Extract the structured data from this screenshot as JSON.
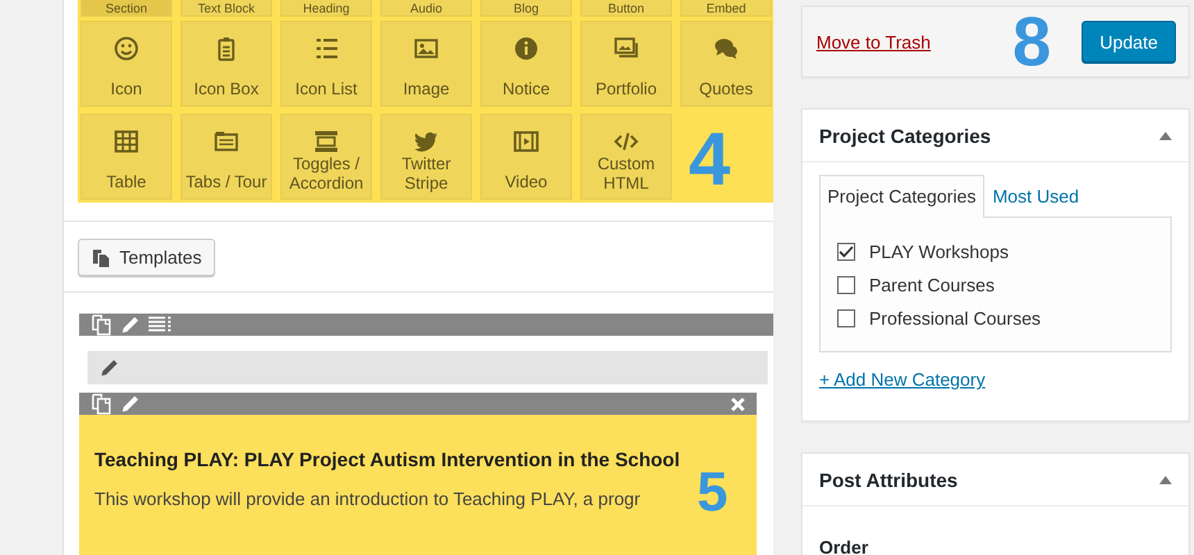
{
  "builder": {
    "cut_row": [
      "Section",
      "Text Block",
      "Heading",
      "Audio",
      "Blog",
      "Button",
      "Embed"
    ],
    "tiles": [
      {
        "label": "Icon",
        "kind": "smiley"
      },
      {
        "label": "Icon Box",
        "kind": "clipboard"
      },
      {
        "label": "Icon List",
        "kind": "list"
      },
      {
        "label": "Image",
        "kind": "image"
      },
      {
        "label": "Notice",
        "kind": "info"
      },
      {
        "label": "Portfolio",
        "kind": "gallery"
      },
      {
        "label": "Quotes",
        "kind": "comments"
      },
      {
        "label": "Table",
        "kind": "table"
      },
      {
        "label": "Tabs / Tour",
        "kind": "tabs"
      },
      {
        "label": "Toggles / Accordion",
        "kind": "toggles"
      },
      {
        "label": "Twitter Stripe",
        "kind": "bird"
      },
      {
        "label": "Video",
        "kind": "film"
      },
      {
        "label": "Custom HTML",
        "kind": "code"
      }
    ],
    "marker": "4"
  },
  "templates_button": "Templates",
  "element": {
    "heading": "Teaching PLAY: PLAY Project Autism Intervention in the School",
    "text": "This workshop will provide an introduction to Teaching PLAY, a progr",
    "marker": "5"
  },
  "publish": {
    "trash_link": "Move to Trash",
    "marker": "8",
    "update_button": "Update"
  },
  "project_categories": {
    "title": "Project Categories",
    "tabs": [
      {
        "label": "Project Categories",
        "selected": true
      },
      {
        "label": "Most Used",
        "selected": false
      }
    ],
    "items": [
      {
        "label": "PLAY Workshops",
        "checked": true
      },
      {
        "label": "Parent Courses",
        "checked": false
      },
      {
        "label": "Professional Courses",
        "checked": false
      }
    ],
    "add_link": "+ Add New Category"
  },
  "post_attributes": {
    "title": "Post Attributes",
    "order_label": "Order"
  }
}
